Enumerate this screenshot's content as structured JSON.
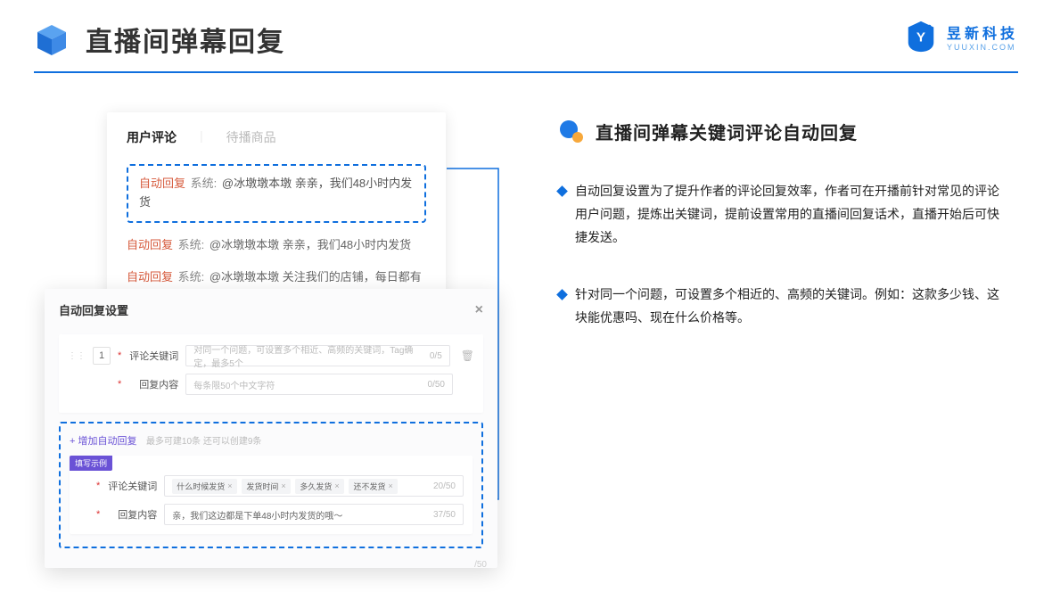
{
  "header": {
    "title": "直播间弹幕回复",
    "brand_cn": "昱新科技",
    "brand_en": "YUUXIN.COM"
  },
  "comments_panel": {
    "tabs": {
      "active": "用户评论",
      "inactive": "待播商品"
    },
    "items": [
      {
        "tag": "自动回复",
        "sys": "系统:",
        "text": "@冰墩墩本墩 亲亲，我们48小时内发货"
      },
      {
        "tag": "自动回复",
        "sys": "系统:",
        "text": "@冰墩墩本墩 亲亲，我们48小时内发货"
      },
      {
        "tag": "自动回复",
        "sys": "系统:",
        "text": "@冰墩墩本墩 关注我们的店铺，每日都有热门推荐呦～"
      }
    ]
  },
  "settings_panel": {
    "title": "自动回复设置",
    "order": "1",
    "label_keyword": "评论关键词",
    "placeholder_keyword": "对同一个问题，可设置多个相近、高频的关键词，Tag确定，最多5个",
    "count_keyword": "0/5",
    "label_content": "回复内容",
    "placeholder_content": "每条限50个中文字符",
    "count_content": "0/50",
    "add_text": "+ 增加自动回复",
    "add_hint": "最多可建10条 还可以创建9条",
    "example": {
      "badge": "填写示例",
      "label_keyword": "评论关键词",
      "tags": [
        "什么时候发货",
        "发货时间",
        "多久发货",
        "还不发货"
      ],
      "count_keyword": "20/50",
      "label_content": "回复内容",
      "value_content": "亲，我们这边都是下单48小时内发货的哦～",
      "count_content": "37/50",
      "floating": "/50"
    }
  },
  "right": {
    "section_title": "直播间弹幕关键词评论自动回复",
    "bullets": [
      "自动回复设置为了提升作者的评论回复效率，作者可在开播前针对常见的评论用户问题，提炼出关键词，提前设置常用的直播间回复话术，直播开始后可快捷发送。",
      "针对同一个问题，可设置多个相近的、高频的关键词。例如：这款多少钱、这块能优惠吗、现在什么价格等。"
    ]
  }
}
